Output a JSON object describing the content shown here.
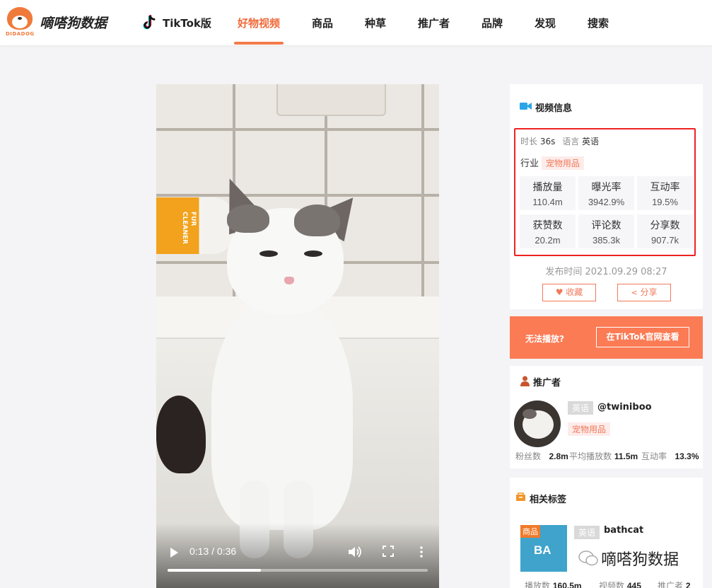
{
  "header": {
    "logo_text": "DIDADOG",
    "brand": "嘀嗒狗数据",
    "nav": [
      {
        "label": "TikTok版"
      },
      {
        "label": "好物视频",
        "active": true
      },
      {
        "label": "商品"
      },
      {
        "label": "种草"
      },
      {
        "label": "推广者"
      },
      {
        "label": "品牌"
      },
      {
        "label": "发现"
      },
      {
        "label": "搜索"
      }
    ],
    "accent_color": "#f06a3a"
  },
  "video": {
    "time": "0:13 / 0:36",
    "progress": 0.36,
    "bottle_text": "FUR CLEANER"
  },
  "video_info": {
    "title": "视频信息",
    "duration_label": "时长",
    "duration": "36s",
    "language_label": "语言",
    "language": "英语",
    "industry_label": "行业",
    "industry": "宠物用品",
    "stats": [
      {
        "label": "播放量",
        "value": "110.4m"
      },
      {
        "label": "曝光率",
        "value": "3942.9%"
      },
      {
        "label": "互动率",
        "value": "19.5%"
      },
      {
        "label": "获赞数",
        "value": "20.2m"
      },
      {
        "label": "评论数",
        "value": "385.3k"
      },
      {
        "label": "分享数",
        "value": "907.7k"
      }
    ],
    "publish_time": "发布时间 2021.09.29 08:27",
    "favorite_label": "收藏",
    "share_label": "分享"
  },
  "cta": {
    "question": "无法播放?",
    "button": "在TikTok官网查看"
  },
  "promoter": {
    "title": "推广者",
    "lang_tag": "英语",
    "handle": "@twiniboo",
    "category": "宠物用品",
    "followers_label": "粉丝数",
    "followers": "2.8m",
    "avg_views_label": "平均播放数",
    "avg_views": "11.5m",
    "engagement_label": "互动率",
    "engagement": "13.3%"
  },
  "tags": {
    "title": "相关标签",
    "item": {
      "badge": "商品",
      "thumb_text": "BA",
      "lang_tag": "英语",
      "name": "bathcat",
      "views_label": "播放数",
      "views": "160.5m",
      "videos_label": "视频数",
      "videos": "445",
      "promoters_label": "推广者",
      "promoters": "2"
    }
  },
  "watermark": "嘀嗒狗数据"
}
